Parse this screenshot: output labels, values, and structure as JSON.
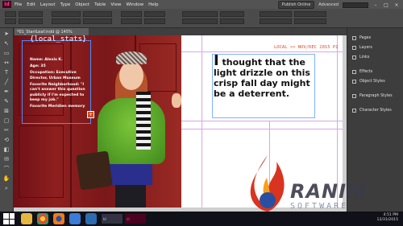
{
  "menubar": {
    "logo": "Id",
    "items": [
      "File",
      "Edit",
      "Layout",
      "Type",
      "Object",
      "Table",
      "View",
      "Window",
      "Help"
    ],
    "publish_label": "Publish Online",
    "workspace": "Advanced"
  },
  "document": {
    "tab_label": "*01_StartLeaf.indd @ 145%"
  },
  "stats": {
    "title": "{local_stats}",
    "name": "Name: Alexis K.",
    "age": "Age: 35",
    "occupation": "Occupation: Executive Director, Urban Museum",
    "favorite_neighborhood": "Favorite Neighborhood: \"I can't answer this question publicly if I'm expected to keep my job.\"",
    "favorite_memory": "Favorite Meridien memory"
  },
  "page": {
    "header": "LOCAL >> NOV/DEC 2015  P1",
    "quote_dropcap": "I",
    "quote_rest": " thought that the light drizzle on this crisp fall day might be a deterrent."
  },
  "panels": {
    "items": [
      "Pages",
      "Layers",
      "Links",
      "Effects",
      "Object Styles",
      "Paragraph Styles",
      "Character Styles"
    ]
  },
  "taskbar": {
    "tabs": [
      "Id",
      "Id"
    ],
    "time": "4:51 PM",
    "date": "12/31/2015"
  },
  "watermark": {
    "brand": "RANIM",
    "sub": "SOFTWARE"
  },
  "colors": {
    "accent_indesign": "#ff3f94",
    "header_red": "#e04a2f",
    "frame_blue": "#4e8cff"
  }
}
